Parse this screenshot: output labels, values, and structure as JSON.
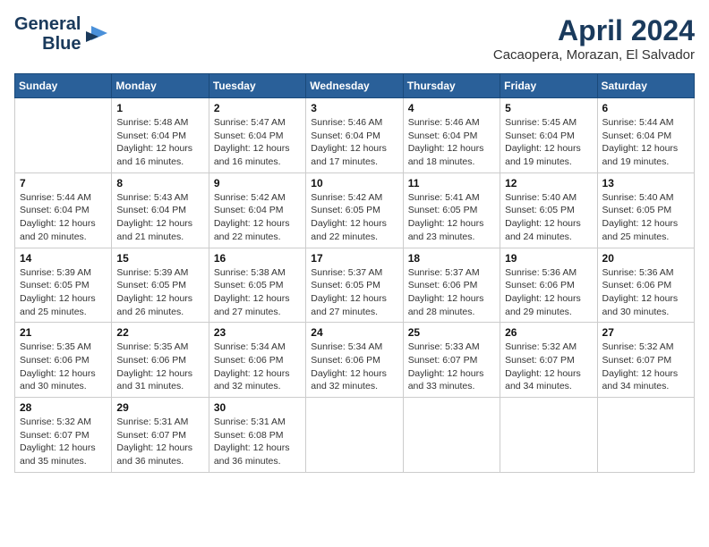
{
  "logo": {
    "line1": "General",
    "line2": "Blue"
  },
  "title": "April 2024",
  "location": "Cacaopera, Morazan, El Salvador",
  "days_of_week": [
    "Sunday",
    "Monday",
    "Tuesday",
    "Wednesday",
    "Thursday",
    "Friday",
    "Saturday"
  ],
  "weeks": [
    [
      {
        "num": "",
        "sunrise": "",
        "sunset": "",
        "daylight": "",
        "empty": true
      },
      {
        "num": "1",
        "sunrise": "Sunrise: 5:48 AM",
        "sunset": "Sunset: 6:04 PM",
        "daylight": "Daylight: 12 hours and 16 minutes."
      },
      {
        "num": "2",
        "sunrise": "Sunrise: 5:47 AM",
        "sunset": "Sunset: 6:04 PM",
        "daylight": "Daylight: 12 hours and 16 minutes."
      },
      {
        "num": "3",
        "sunrise": "Sunrise: 5:46 AM",
        "sunset": "Sunset: 6:04 PM",
        "daylight": "Daylight: 12 hours and 17 minutes."
      },
      {
        "num": "4",
        "sunrise": "Sunrise: 5:46 AM",
        "sunset": "Sunset: 6:04 PM",
        "daylight": "Daylight: 12 hours and 18 minutes."
      },
      {
        "num": "5",
        "sunrise": "Sunrise: 5:45 AM",
        "sunset": "Sunset: 6:04 PM",
        "daylight": "Daylight: 12 hours and 19 minutes."
      },
      {
        "num": "6",
        "sunrise": "Sunrise: 5:44 AM",
        "sunset": "Sunset: 6:04 PM",
        "daylight": "Daylight: 12 hours and 19 minutes."
      }
    ],
    [
      {
        "num": "7",
        "sunrise": "Sunrise: 5:44 AM",
        "sunset": "Sunset: 6:04 PM",
        "daylight": "Daylight: 12 hours and 20 minutes."
      },
      {
        "num": "8",
        "sunrise": "Sunrise: 5:43 AM",
        "sunset": "Sunset: 6:04 PM",
        "daylight": "Daylight: 12 hours and 21 minutes."
      },
      {
        "num": "9",
        "sunrise": "Sunrise: 5:42 AM",
        "sunset": "Sunset: 6:04 PM",
        "daylight": "Daylight: 12 hours and 22 minutes."
      },
      {
        "num": "10",
        "sunrise": "Sunrise: 5:42 AM",
        "sunset": "Sunset: 6:05 PM",
        "daylight": "Daylight: 12 hours and 22 minutes."
      },
      {
        "num": "11",
        "sunrise": "Sunrise: 5:41 AM",
        "sunset": "Sunset: 6:05 PM",
        "daylight": "Daylight: 12 hours and 23 minutes."
      },
      {
        "num": "12",
        "sunrise": "Sunrise: 5:40 AM",
        "sunset": "Sunset: 6:05 PM",
        "daylight": "Daylight: 12 hours and 24 minutes."
      },
      {
        "num": "13",
        "sunrise": "Sunrise: 5:40 AM",
        "sunset": "Sunset: 6:05 PM",
        "daylight": "Daylight: 12 hours and 25 minutes."
      }
    ],
    [
      {
        "num": "14",
        "sunrise": "Sunrise: 5:39 AM",
        "sunset": "Sunset: 6:05 PM",
        "daylight": "Daylight: 12 hours and 25 minutes."
      },
      {
        "num": "15",
        "sunrise": "Sunrise: 5:39 AM",
        "sunset": "Sunset: 6:05 PM",
        "daylight": "Daylight: 12 hours and 26 minutes."
      },
      {
        "num": "16",
        "sunrise": "Sunrise: 5:38 AM",
        "sunset": "Sunset: 6:05 PM",
        "daylight": "Daylight: 12 hours and 27 minutes."
      },
      {
        "num": "17",
        "sunrise": "Sunrise: 5:37 AM",
        "sunset": "Sunset: 6:05 PM",
        "daylight": "Daylight: 12 hours and 27 minutes."
      },
      {
        "num": "18",
        "sunrise": "Sunrise: 5:37 AM",
        "sunset": "Sunset: 6:06 PM",
        "daylight": "Daylight: 12 hours and 28 minutes."
      },
      {
        "num": "19",
        "sunrise": "Sunrise: 5:36 AM",
        "sunset": "Sunset: 6:06 PM",
        "daylight": "Daylight: 12 hours and 29 minutes."
      },
      {
        "num": "20",
        "sunrise": "Sunrise: 5:36 AM",
        "sunset": "Sunset: 6:06 PM",
        "daylight": "Daylight: 12 hours and 30 minutes."
      }
    ],
    [
      {
        "num": "21",
        "sunrise": "Sunrise: 5:35 AM",
        "sunset": "Sunset: 6:06 PM",
        "daylight": "Daylight: 12 hours and 30 minutes."
      },
      {
        "num": "22",
        "sunrise": "Sunrise: 5:35 AM",
        "sunset": "Sunset: 6:06 PM",
        "daylight": "Daylight: 12 hours and 31 minutes."
      },
      {
        "num": "23",
        "sunrise": "Sunrise: 5:34 AM",
        "sunset": "Sunset: 6:06 PM",
        "daylight": "Daylight: 12 hours and 32 minutes."
      },
      {
        "num": "24",
        "sunrise": "Sunrise: 5:34 AM",
        "sunset": "Sunset: 6:06 PM",
        "daylight": "Daylight: 12 hours and 32 minutes."
      },
      {
        "num": "25",
        "sunrise": "Sunrise: 5:33 AM",
        "sunset": "Sunset: 6:07 PM",
        "daylight": "Daylight: 12 hours and 33 minutes."
      },
      {
        "num": "26",
        "sunrise": "Sunrise: 5:32 AM",
        "sunset": "Sunset: 6:07 PM",
        "daylight": "Daylight: 12 hours and 34 minutes."
      },
      {
        "num": "27",
        "sunrise": "Sunrise: 5:32 AM",
        "sunset": "Sunset: 6:07 PM",
        "daylight": "Daylight: 12 hours and 34 minutes."
      }
    ],
    [
      {
        "num": "28",
        "sunrise": "Sunrise: 5:32 AM",
        "sunset": "Sunset: 6:07 PM",
        "daylight": "Daylight: 12 hours and 35 minutes."
      },
      {
        "num": "29",
        "sunrise": "Sunrise: 5:31 AM",
        "sunset": "Sunset: 6:07 PM",
        "daylight": "Daylight: 12 hours and 36 minutes."
      },
      {
        "num": "30",
        "sunrise": "Sunrise: 5:31 AM",
        "sunset": "Sunset: 6:08 PM",
        "daylight": "Daylight: 12 hours and 36 minutes."
      },
      {
        "num": "",
        "sunrise": "",
        "sunset": "",
        "daylight": "",
        "empty": true
      },
      {
        "num": "",
        "sunrise": "",
        "sunset": "",
        "daylight": "",
        "empty": true
      },
      {
        "num": "",
        "sunrise": "",
        "sunset": "",
        "daylight": "",
        "empty": true
      },
      {
        "num": "",
        "sunrise": "",
        "sunset": "",
        "daylight": "",
        "empty": true
      }
    ]
  ]
}
